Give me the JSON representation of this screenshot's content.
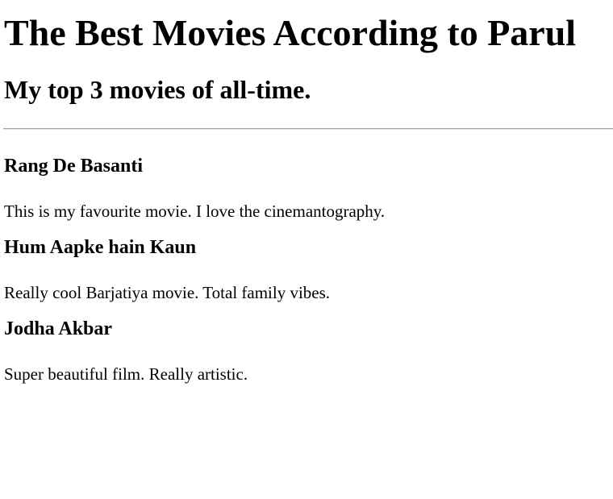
{
  "page": {
    "title": "The Best Movies According to Parul",
    "subtitle": "My top 3 movies of all-time."
  },
  "movies": [
    {
      "title": "Rang De Basanti",
      "description": "This is my favourite movie. I love the cinemantography."
    },
    {
      "title": "Hum Aapke hain Kaun",
      "description": "Really cool Barjatiya movie. Total family vibes."
    },
    {
      "title": "Jodha Akbar",
      "description": "Super beautiful film. Really artistic."
    }
  ]
}
